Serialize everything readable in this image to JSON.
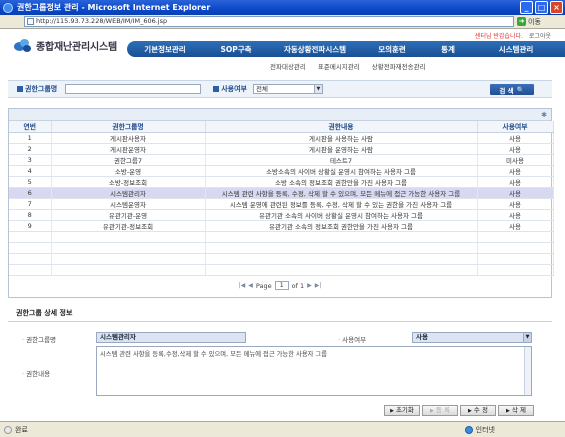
{
  "window": {
    "title": "권한그룹정보 관리 - Microsoft Internet Explorer",
    "address": "http://115.93.73.228/WEB/IM/IM_606.jsp",
    "go_label": "이동"
  },
  "header": {
    "user_text": "센터님 반갑습니다.",
    "logout": "로그아웃",
    "logo_title": "종합재난관리시스템",
    "nav": [
      "기본정보관리",
      "SOP구축",
      "자동상황전파시스템",
      "모의훈련",
      "통계",
      "시스템관리"
    ],
    "subnav": [
      "전파대상관리",
      "표준메시지관리",
      "상황전파재전송관리"
    ]
  },
  "search": {
    "group_label": "권한그룹명",
    "use_label": "사용여부",
    "use_value": "전체",
    "button": "검 색"
  },
  "table": {
    "columns": [
      "연번",
      "권한그룹명",
      "권한내용",
      "사용여부"
    ],
    "rows": [
      {
        "no": "1",
        "name": "게시판사용자",
        "desc": "게시판을 사용하는 사람",
        "use": "사용"
      },
      {
        "no": "2",
        "name": "게시판운영자",
        "desc": "게시판을 운영하는 사람",
        "use": "사용"
      },
      {
        "no": "3",
        "name": "권한그룹7",
        "desc": "테스트7",
        "use": "미사용"
      },
      {
        "no": "4",
        "name": "소방-운영",
        "desc": "소방소속의 사이버 상황실 운영시 참여하는 사용자 그룹",
        "use": "사용"
      },
      {
        "no": "5",
        "name": "소방-정보조회",
        "desc": "소방 소속의 정보조회 권한만을 가진 사용자 그룹",
        "use": "사용"
      },
      {
        "no": "6",
        "name": "시스템관리자",
        "desc": "시스템 관련 사항을 등록, 수정, 삭제 할 수 있으며, 모든 메뉴에 접근 가능한 사용자 그룹",
        "use": "사용"
      },
      {
        "no": "7",
        "name": "시스템운영자",
        "desc": "시스템 운영에 관련된 정보를 등록, 수정, 삭제 할 수 있는 권한을 가진 사용자 그룹",
        "use": "사용"
      },
      {
        "no": "8",
        "name": "유관기관-운영",
        "desc": "유관기관 소속의 사이버 상황실 운영시 참여하는 사용자 그룹",
        "use": "사용"
      },
      {
        "no": "9",
        "name": "유관기관-정보조회",
        "desc": "유관기관 소속의 정보조회 권한만을 가진 사용자 그룹",
        "use": "사용"
      }
    ],
    "selected_index": 5,
    "pager": {
      "label": "Page",
      "current": "1",
      "of": "of 1"
    }
  },
  "detail": {
    "title": "권한그룹 상세 정보",
    "name_label": "권한그룹명",
    "name_value": "시스템관리자",
    "use_label": "사용여부",
    "use_value": "사용",
    "desc_label": "권한내용",
    "desc_value": "시스템 관련 사항을 등록,수정,삭제 할 수 있으며, 모든 메뉴에 접근 가능한 사용자 그룹",
    "buttons": {
      "reset": "초기화",
      "register": "등 록",
      "modify": "수 정",
      "delete": "삭 제"
    }
  },
  "status": {
    "left": "완료",
    "zone": "인터넷"
  },
  "colors": {
    "nav": "#1f5aa5",
    "selected_row": "#d8d8f0",
    "title_bar": "#0b48c9"
  }
}
